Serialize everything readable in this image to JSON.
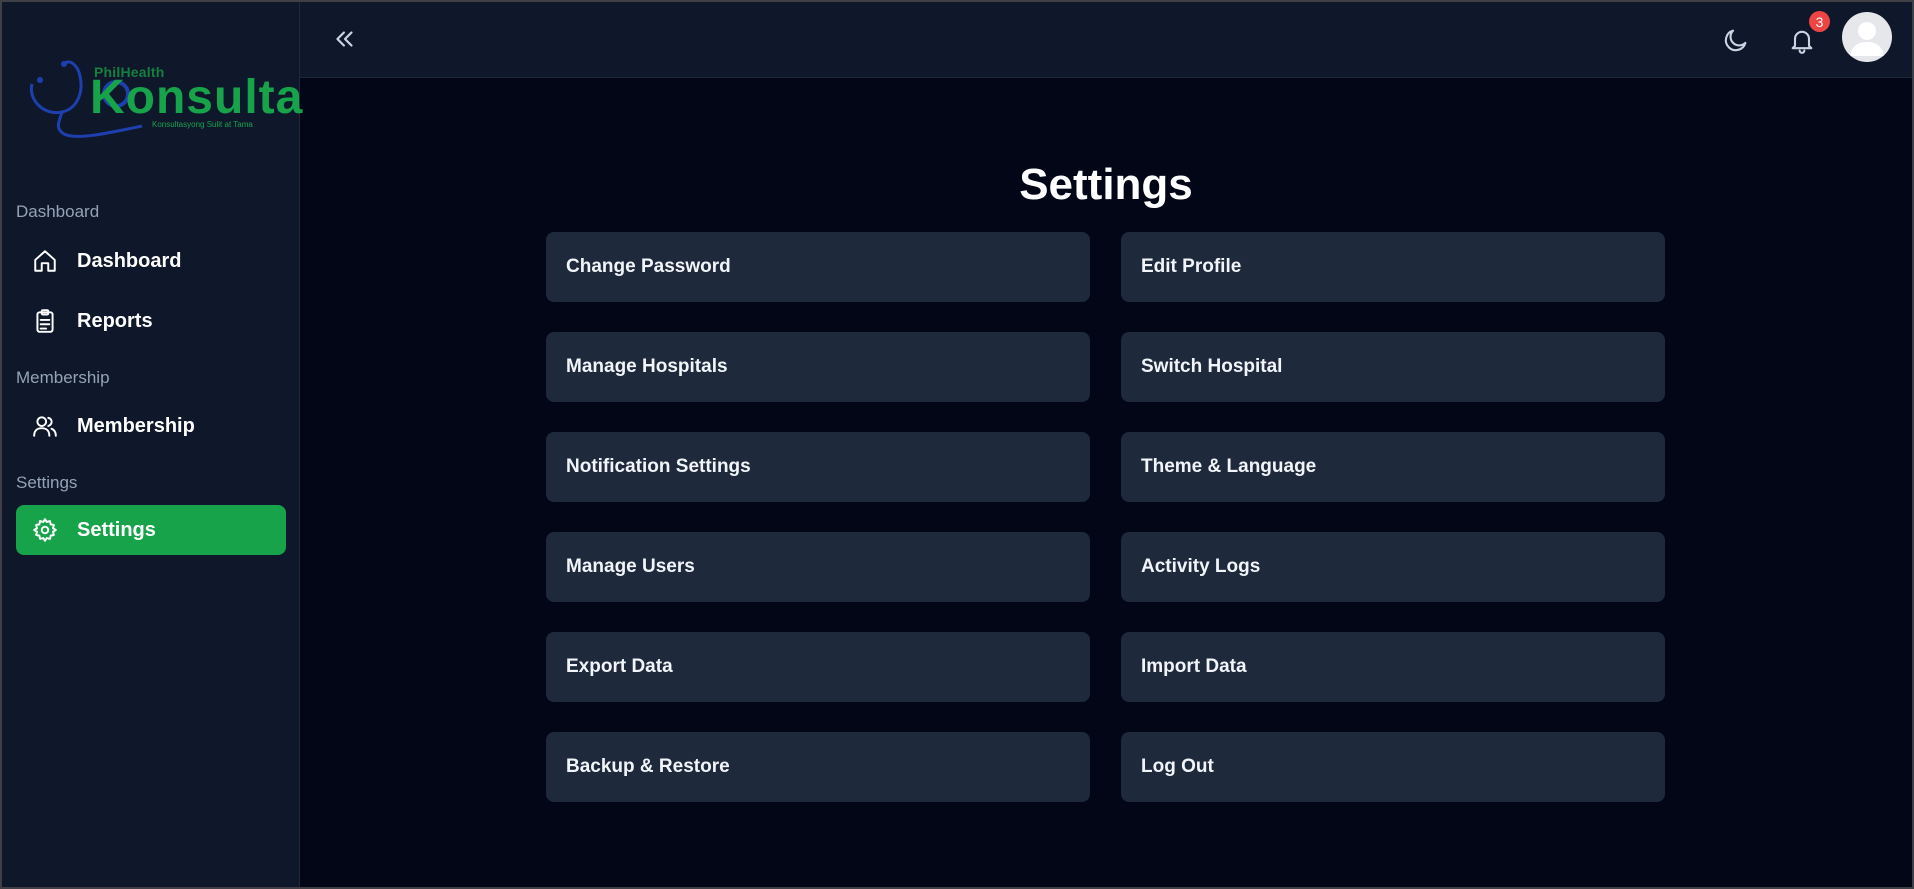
{
  "sidebar": {
    "logo": {
      "brand_small": "PhilHealth",
      "brand_big": "Konsulta",
      "tagline": "Konsultasyong Sulit at Tama"
    },
    "sections": [
      {
        "label": "Dashboard"
      },
      {
        "label": "Membership"
      },
      {
        "label": "Settings"
      }
    ],
    "items": [
      {
        "label": "Dashboard",
        "icon": "home-icon"
      },
      {
        "label": "Reports",
        "icon": "clipboard-icon"
      },
      {
        "label": "Membership",
        "icon": "users-icon"
      },
      {
        "label": "Settings",
        "icon": "gear-icon",
        "active": true
      }
    ],
    "active_color": "#16a34a"
  },
  "topbar": {
    "notification_count": "3"
  },
  "main": {
    "title": "Settings",
    "cards": [
      "Change Password",
      "Edit Profile",
      "Manage Hospitals",
      "Switch Hospital",
      "Notification Settings",
      "Theme & Language",
      "Manage Users",
      "Activity Logs",
      "Export Data",
      "Import Data",
      "Backup & Restore",
      "Log Out"
    ]
  }
}
